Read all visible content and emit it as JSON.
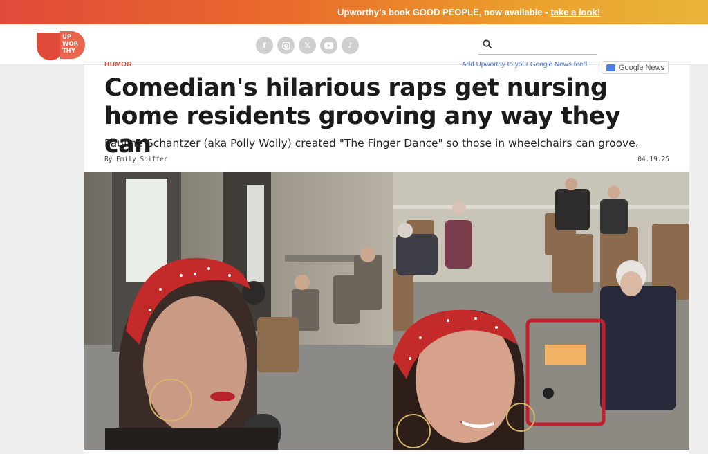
{
  "promo": {
    "text": "Upworthy's book GOOD PEOPLE, now available - ",
    "link_text": "take a look!"
  },
  "header": {
    "logo_lines": [
      "UP",
      "WOR",
      "THY"
    ],
    "social_icons": [
      "facebook-icon",
      "instagram-icon",
      "x-icon",
      "youtube-icon",
      "tiktok-icon"
    ],
    "search_placeholder": ""
  },
  "article": {
    "category": "HUMOR",
    "google_news_prompt": "Add Upworthy to your Google News feed.",
    "google_news_button": "Google News",
    "headline": "Comedian's hilarious raps get nursing home residents grooving any way they can",
    "dek": "Pauline Schantzer (aka Polly Wolly) created \"The Finger Dance\" so those in wheelchairs can groove.",
    "byline": "By Emily Shiffer",
    "date": "04.19.25"
  },
  "colors": {
    "brand": "#e04a3a",
    "promo_gradient_end": "#e9b43b"
  }
}
